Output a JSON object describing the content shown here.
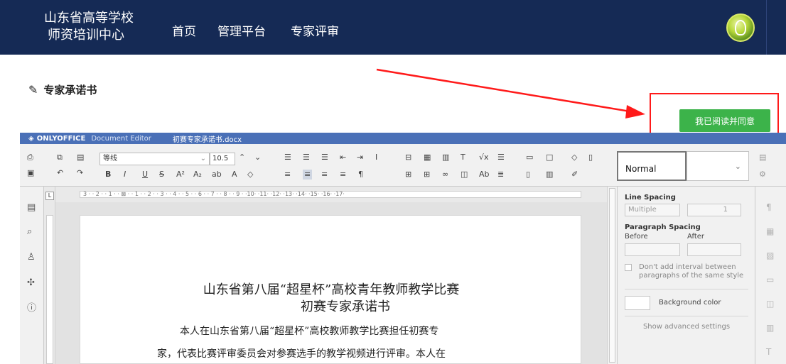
{
  "topbar": {
    "brand_line1": "山东省高等学校",
    "brand_line2": "师资培训中心",
    "nav": [
      "首页",
      "管理平台",
      "专家评审"
    ],
    "avatar_icon": "user-avatar-icon"
  },
  "page": {
    "title": "专家承诺书",
    "title_icon": "pencil-icon",
    "agree_button": "我已阅读并同意",
    "accent_green": "#3cb34a",
    "highlight_red": "#ff1a1a",
    "navbar_color": "#152a55"
  },
  "editor": {
    "brand": "ONLYOFFICE",
    "product": "Document Editor",
    "doc_name": "初赛专家承诺书.docx",
    "header_color": "#4a70b7",
    "toolbar": {
      "font_name": "等线",
      "font_size": "10.5",
      "paragraph_style": "Normal"
    },
    "ruler_text": "3 · · 2 · · 1 · · ⊠ · · 1 · · 2 · · 3 · · 4 · · 5 · · 6 · · 7 · · 8 · · 9 · ·10· ·11· ·12· ·13· ·14· ·15· ·16· ·17·",
    "ruler_corner": "L",
    "document": {
      "title_line1": "山东省第八届“超星杯”高校青年教师教学比赛",
      "title_line2": "初赛专家承诺书",
      "para_line1": "本人在山东省第八届“超星杯”高校教师教学比赛担任初赛专",
      "para_line2": "家，代表比赛评审委员会对参赛选手的教学视频进行评审。本人在"
    },
    "right_panel": {
      "line_spacing_label": "Line Spacing",
      "line_spacing_value": "Multiple",
      "line_spacing_amount": "1",
      "paragraph_spacing_label": "Paragraph Spacing",
      "before_label": "Before",
      "after_label": "After",
      "dont_add_interval": "Don't add interval between paragraphs of the same style",
      "background_color": "Background color",
      "advanced_settings": "Show advanced settings"
    }
  }
}
